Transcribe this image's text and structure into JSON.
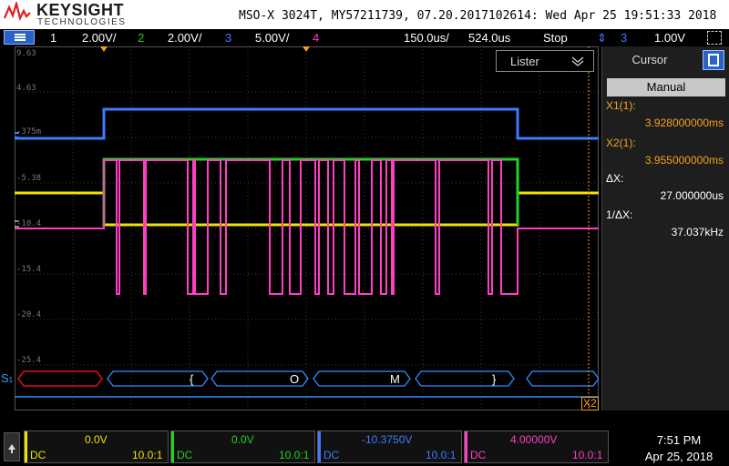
{
  "header": {
    "brand": "KEYSIGHT",
    "brand_sub": "TECHNOLOGIES",
    "model_line": "MSO-X 3024T, MY57211739, 07.20.2017102614: Wed Apr 25 19:51:33 2018"
  },
  "channel_bar": {
    "ch1_num": "1",
    "ch1_scale": "2.00V/",
    "ch2_num": "2",
    "ch2_scale": "2.00V/",
    "ch3_num": "3",
    "ch3_scale": "5.00V/",
    "ch4_num": "4",
    "timebase": "150.0us/",
    "delay": "524.0us",
    "run_state": "Stop",
    "trigger_source": "3",
    "trigger_level": "1.00V"
  },
  "colors": {
    "ch1": "#f2e200",
    "ch2": "#21d321",
    "ch3": "#3d7cff",
    "ch4": "#ff3fc3",
    "cursor_value": "#f7a01e",
    "bus_red": "#e01010",
    "bus_blue": "#2f8fff"
  },
  "graticule_labels": [
    "9.63",
    "4.63",
    "-375m",
    "-5.38",
    "-10.4",
    "-15.4",
    "-20.4",
    "-25.4"
  ],
  "bus": {
    "label": "S",
    "label_sub": "1",
    "symbols": [
      "{",
      "O",
      "M",
      "}"
    ],
    "cursor_marker": "X2"
  },
  "listener": {
    "label": "Lister"
  },
  "cursor_panel": {
    "title": "Cursor",
    "mode": "Manual",
    "x1_label": "X1(1):",
    "x1_value": "3.928000000ms",
    "x2_label": "X2(1):",
    "x2_value": "3.955000000ms",
    "dx_label": "ΔX:",
    "dx_value": "27.000000us",
    "inv_dx_label": "1/ΔX:",
    "inv_dx_value": "37.037kHz"
  },
  "footer": {
    "ch1_offset": "0.0V",
    "ch1_coupling": "DC",
    "ch1_probe": "10.0:1",
    "ch2_offset": "0.0V",
    "ch2_coupling": "DC",
    "ch2_probe": "10.0:1",
    "ch3_offset": "-10.3750V",
    "ch3_coupling": "DC",
    "ch3_probe": "10.0:1",
    "ch4_offset": "4.00000V",
    "ch4_coupling": "DC",
    "ch4_probe": "10.0:1",
    "time": "7:51 PM",
    "date": "Apr 25, 2018"
  },
  "icons": [
    "keysight-logo-icon",
    "menu-icon",
    "listener-collapse-icon",
    "panel-toggle-icon",
    "trigger-slope-icon",
    "footer-expand-icon"
  ]
}
